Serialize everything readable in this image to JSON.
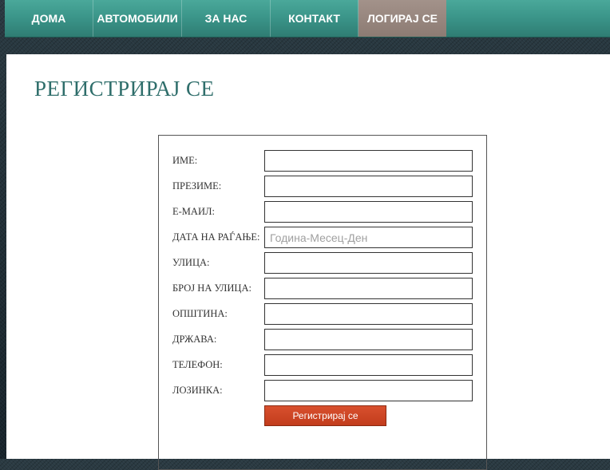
{
  "nav": {
    "items": [
      {
        "label": "ДОМА",
        "active": false
      },
      {
        "label": "АВТОМОБИЛИ",
        "active": false
      },
      {
        "label": "ЗА НАС",
        "active": false
      },
      {
        "label": "КОНТАКТ",
        "active": false
      },
      {
        "label": "ЛОГИРАЈ СЕ",
        "active": true
      }
    ]
  },
  "page": {
    "title": "РЕГИСТРИРАЈ СЕ"
  },
  "form": {
    "fields": [
      {
        "label": "ИМЕ:",
        "value": "",
        "placeholder": ""
      },
      {
        "label": "ПРЕЗИМЕ:",
        "value": "",
        "placeholder": ""
      },
      {
        "label": "Е-МАИЛ:",
        "value": "",
        "placeholder": ""
      },
      {
        "label": "ДАТА НА РАЃАЊЕ:",
        "value": "",
        "placeholder": "Година-Месец-Ден"
      },
      {
        "label": "УЛИЦА:",
        "value": "",
        "placeholder": ""
      },
      {
        "label": "БРОЈ НА УЛИЦА:",
        "value": "",
        "placeholder": ""
      },
      {
        "label": "ОПШТИНА:",
        "value": "",
        "placeholder": ""
      },
      {
        "label": "ДРЖАВА:",
        "value": "",
        "placeholder": ""
      },
      {
        "label": "ТЕЛЕФОН:",
        "value": "",
        "placeholder": ""
      },
      {
        "label": "ЛОЗИНКА:",
        "value": "",
        "placeholder": ""
      }
    ],
    "submit_label": "Регистрирај се"
  },
  "colors": {
    "nav_teal": "#3a9488",
    "nav_active": "#9a8981",
    "title_teal": "#2f6e6b",
    "button_red": "#c94424"
  }
}
